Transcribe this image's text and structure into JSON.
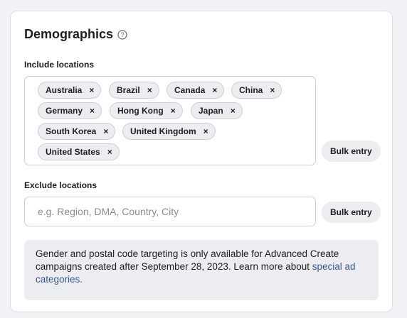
{
  "title": "Demographics",
  "include": {
    "label": "Include locations",
    "chips": [
      "Australia",
      "Brazil",
      "Canada",
      "China",
      "Germany",
      "Hong Kong",
      "Japan",
      "South Korea",
      "United Kingdom",
      "United States"
    ],
    "remove_glyph": "×",
    "bulk_label": "Bulk entry"
  },
  "exclude": {
    "label": "Exclude locations",
    "placeholder": "e.g. Region, DMA, Country, City",
    "bulk_label": "Bulk entry"
  },
  "notice": {
    "text": "Gender and postal code targeting is only available for Advanced Create campaigns created after September 28, 2023. Learn more about ",
    "link": "special ad categories."
  },
  "colors": {
    "link": "#385898",
    "chip_bg": "#ebedf0",
    "border": "#ccd0d5"
  }
}
